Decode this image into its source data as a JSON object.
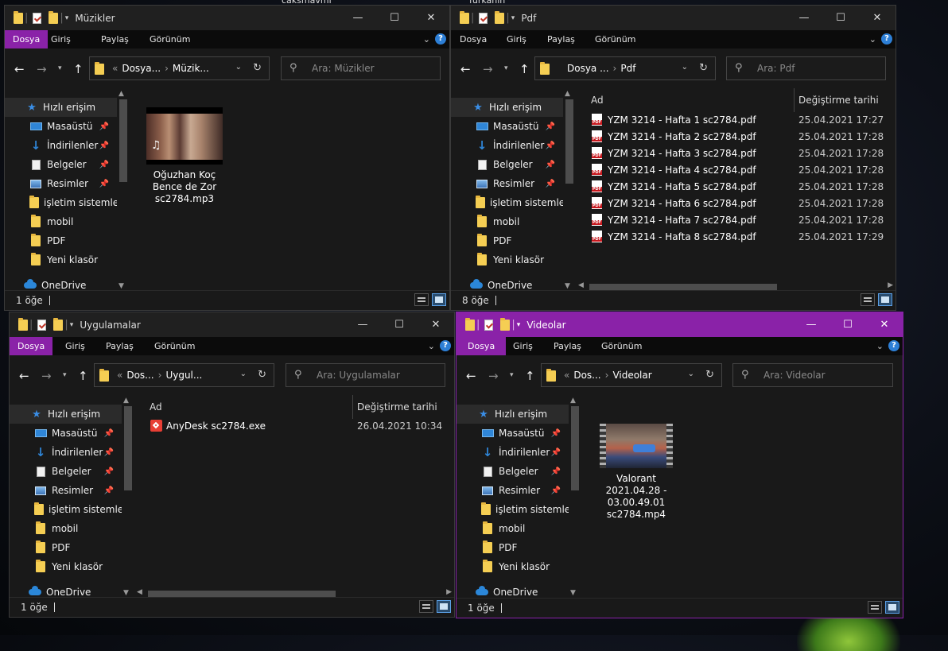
{
  "desktop": {
    "labels": [
      "caksmavml",
      "furkanin"
    ]
  },
  "common": {
    "ribbon_tabs": [
      "Dosya",
      "Giriş",
      "Paylaş",
      "Görünüm"
    ],
    "nav_items": [
      {
        "label": "Hızlı erişim",
        "icon": "star-icon"
      },
      {
        "label": "Masaüstü",
        "icon": "desktop-icon",
        "pinned": true
      },
      {
        "label": "İndirilenler",
        "icon": "download-icon",
        "pinned": true
      },
      {
        "label": "Belgeler",
        "icon": "documents-icon",
        "pinned": true
      },
      {
        "label": "Resimler",
        "icon": "pictures-icon",
        "pinned": true
      },
      {
        "label": "işletim sistemler",
        "icon": "folder-icon"
      },
      {
        "label": "mobil",
        "icon": "folder-icon"
      },
      {
        "label": "PDF",
        "icon": "folder-icon"
      },
      {
        "label": "Yeni klasör",
        "icon": "folder-icon"
      },
      {
        "label": "OneDrive",
        "icon": "onedrive-icon"
      }
    ],
    "col_name": "Ad",
    "col_date": "Değiştirme tarihi",
    "help": "?"
  },
  "windows": {
    "muzikler": {
      "title": "Müzikler",
      "crumbs": [
        "Dosya...",
        "Müzik..."
      ],
      "search_placeholder": "Ara: Müzikler",
      "status": "1 öğe",
      "tiles": [
        {
          "name": "Oğuzhan Koç Bence de Zor sc2784.mp3"
        }
      ]
    },
    "pdf": {
      "title": "Pdf",
      "crumbs": [
        "Dosya ...",
        "Pdf"
      ],
      "search_placeholder": "Ara: Pdf",
      "status": "8 öğe",
      "files": [
        {
          "name": "YZM 3214 - Hafta 1 sc2784.pdf",
          "date": "25.04.2021 17:27"
        },
        {
          "name": "YZM 3214 - Hafta 2 sc2784.pdf",
          "date": "25.04.2021 17:28"
        },
        {
          "name": "YZM 3214 - Hafta 3 sc2784.pdf",
          "date": "25.04.2021 17:28"
        },
        {
          "name": "YZM 3214 - Hafta 4 sc2784.pdf",
          "date": "25.04.2021 17:28"
        },
        {
          "name": "YZM 3214 - Hafta 5 sc2784.pdf",
          "date": "25.04.2021 17:28"
        },
        {
          "name": "YZM 3214 - Hafta 6 sc2784.pdf",
          "date": "25.04.2021 17:28"
        },
        {
          "name": "YZM 3214 - Hafta 7 sc2784.pdf",
          "date": "25.04.2021 17:28"
        },
        {
          "name": "YZM 3214 - Hafta 8 sc2784.pdf",
          "date": "25.04.2021 17:29"
        }
      ]
    },
    "uygulamalar": {
      "title": "Uygulamalar",
      "crumbs": [
        "Dos...",
        "Uygul..."
      ],
      "search_placeholder": "Ara: Uygulamalar",
      "status": "1 öğe",
      "files": [
        {
          "name": "AnyDesk sc2784.exe",
          "date": "26.04.2021 10:34"
        }
      ]
    },
    "videolar": {
      "title": "Videolar",
      "crumbs": [
        "Dos...",
        "Videolar"
      ],
      "search_placeholder": "Ara: Videolar",
      "status": "1 öğe",
      "tiles": [
        {
          "name": "Valorant 2021.04.28 - 03.00.49.01 sc2784.mp4"
        }
      ]
    }
  }
}
